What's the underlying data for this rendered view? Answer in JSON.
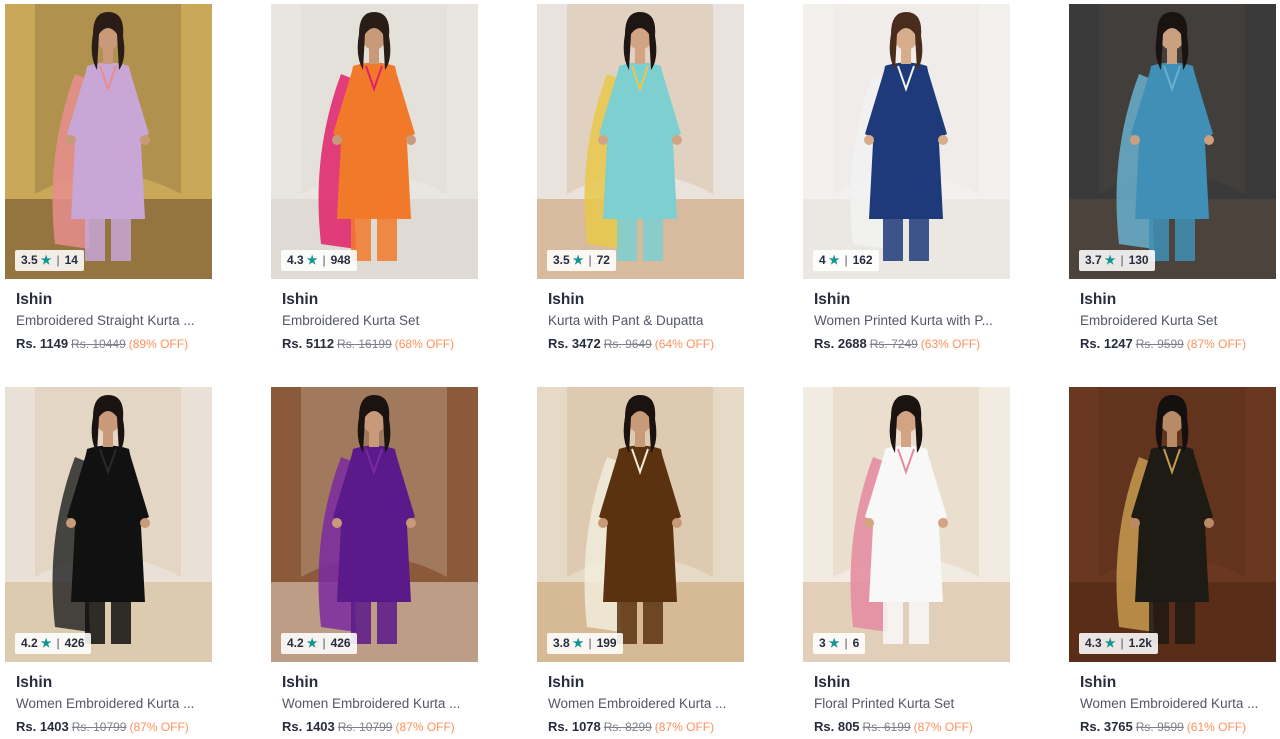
{
  "products": [
    {
      "brand": "Ishin",
      "name": "Embroidered Straight Kurta ...",
      "price": "Rs. 1149",
      "mrp": "Rs. 10449",
      "discount": "(89% OFF)",
      "rating": "3.5",
      "count": "14",
      "palette": {
        "bg": "#c9a85a",
        "bg2": "#6a4a2a",
        "dress": "#c8a6d6",
        "accent": "#e88e8e",
        "skin": "#c99a7a",
        "hair": "#2a1c16"
      }
    },
    {
      "brand": "Ishin",
      "name": "Embroidered Kurta Set",
      "price": "Rs. 5112",
      "mrp": "Rs. 16199",
      "discount": "(68% OFF)",
      "rating": "4.3",
      "count": "948",
      "palette": {
        "bg": "#e9e6e1",
        "bg2": "#d7d2cb",
        "dress": "#f07a2a",
        "accent": "#e2206a",
        "skin": "#c99a7a",
        "hair": "#2a1c16"
      }
    },
    {
      "brand": "Ishin",
      "name": "Kurta with Pant & Dupatta",
      "price": "Rs. 3472",
      "mrp": "Rs. 9649",
      "discount": "(64% OFF)",
      "rating": "3.5",
      "count": "72",
      "palette": {
        "bg": "#eae3dd",
        "bg2": "#c89a6a",
        "dress": "#7dcfd0",
        "accent": "#e8c84a",
        "skin": "#d2a484",
        "hair": "#1e1612"
      }
    },
    {
      "brand": "Ishin",
      "name": "Women Printed Kurta with P...",
      "price": "Rs. 2688",
      "mrp": "Rs. 7249",
      "discount": "(63% OFF)",
      "rating": "4",
      "count": "162",
      "palette": {
        "bg": "#f3f1ee",
        "bg2": "#e4e0da",
        "dress": "#1f3a7a",
        "accent": "#f2f2f2",
        "skin": "#d6ae8c",
        "hair": "#4a2c1c"
      }
    },
    {
      "brand": "Ishin",
      "name": "Embroidered Kurta Set",
      "price": "Rs. 1247",
      "mrp": "Rs. 9599",
      "discount": "(87% OFF)",
      "rating": "3.7",
      "count": "130",
      "palette": {
        "bg": "#3a3a3a",
        "bg2": "#5c4a40",
        "dress": "#3f8fb6",
        "accent": "#6ab0cf",
        "skin": "#caa080",
        "hair": "#1a1310"
      }
    },
    {
      "brand": "Ishin",
      "name": "Women Embroidered Kurta ...",
      "price": "Rs. 1403",
      "mrp": "Rs. 10799",
      "discount": "(87% OFF)",
      "rating": "4.2",
      "count": "426",
      "palette": {
        "bg": "#e9e1d6",
        "bg2": "#d2b990",
        "dress": "#111111",
        "accent": "#2a2a2a",
        "skin": "#c99a7a",
        "hair": "#1a1310"
      }
    },
    {
      "brand": "Ishin",
      "name": "Women Embroidered Kurta ...",
      "price": "Rs. 1403",
      "mrp": "Rs. 10799",
      "discount": "(87% OFF)",
      "rating": "4.2",
      "count": "426",
      "palette": {
        "bg": "#8a5a3a",
        "bg2": "#e8d6c4",
        "dress": "#5a1a8a",
        "accent": "#7a2aa0",
        "skin": "#c99a7a",
        "hair": "#1a1310"
      }
    },
    {
      "brand": "Ishin",
      "name": "Women Embroidered Kurta ...",
      "price": "Rs. 1078",
      "mrp": "Rs. 8299",
      "discount": "(87% OFF)",
      "rating": "3.8",
      "count": "199",
      "palette": {
        "bg": "#e6d9c6",
        "bg2": "#c8a070",
        "dress": "#5a3210",
        "accent": "#f2ecdc",
        "skin": "#c99a7a",
        "hair": "#1a1310"
      }
    },
    {
      "brand": "Ishin",
      "name": "Floral Printed Kurta Set",
      "price": "Rs. 805",
      "mrp": "Rs. 6199",
      "discount": "(87% OFF)",
      "rating": "3",
      "count": "6",
      "palette": {
        "bg": "#f1ebe2",
        "bg2": "#d6b898",
        "dress": "#f8f8f8",
        "accent": "#e48aa0",
        "skin": "#d2a484",
        "hair": "#1a1310"
      }
    },
    {
      "brand": "Ishin",
      "name": "Women Embroidered Kurta ...",
      "price": "Rs. 3765",
      "mrp": "Rs. 9599",
      "discount": "(61% OFF)",
      "rating": "4.3",
      "count": "1.2k",
      "palette": {
        "bg": "#6a3820",
        "bg2": "#4a2412",
        "dress": "#1e1a14",
        "accent": "#c89a50",
        "skin": "#b98a66",
        "hair": "#141010"
      }
    }
  ]
}
